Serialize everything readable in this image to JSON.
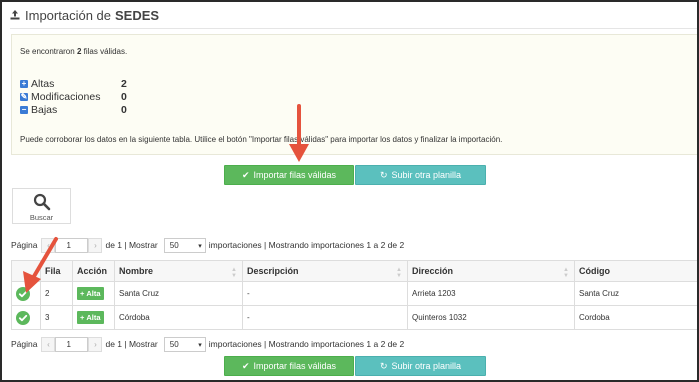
{
  "page": {
    "title_prefix": "Importación de",
    "title_strong": "SEDES"
  },
  "summary": {
    "found_prefix": "Se encontraron",
    "found_count": "2",
    "found_suffix": "filas válidas.",
    "stats": [
      {
        "icon": "plus-square-icon",
        "label": "Altas",
        "value": "2"
      },
      {
        "icon": "edit-square-icon",
        "label": "Modificaciones",
        "value": "0"
      },
      {
        "icon": "minus-square-icon",
        "label": "Bajas",
        "value": "0"
      }
    ],
    "note": "Puede corroborar los datos en la siguiente tabla. Utilice el botón \"Importar filas válidas\" para importar los datos y finalizar la importación."
  },
  "actions": {
    "import_label": "Importar filas válidas",
    "reupload_label": "Subir otra planilla"
  },
  "search": {
    "label": "Buscar"
  },
  "pager": {
    "page_label": "Página",
    "page_value": "1",
    "of_text": "de 1 | Mostrar",
    "page_size": "50",
    "summary": "importaciones | Mostrando importaciones 1 a 2 de 2"
  },
  "table": {
    "columns": [
      "",
      "Fila",
      "Acción",
      "Nombre",
      "Descripción",
      "Dirección",
      "Código"
    ],
    "rows": [
      {
        "status": "check-circle-icon",
        "fila": "2",
        "accion": "Alta",
        "nombre": "Santa Cruz",
        "descripcion": "-",
        "direccion": "Arrieta 1203",
        "codigo": "Santa Cruz"
      },
      {
        "status": "check-circle-icon",
        "fila": "3",
        "accion": "Alta",
        "nombre": "Córdoba",
        "descripcion": "-",
        "direccion": "Quinteros 1032",
        "codigo": "Cordoba"
      }
    ]
  },
  "colors": {
    "success": "#5cb85c",
    "info": "#5bc0be",
    "primary": "#3a7bd5",
    "annotation_arrow": "#e5533d"
  }
}
